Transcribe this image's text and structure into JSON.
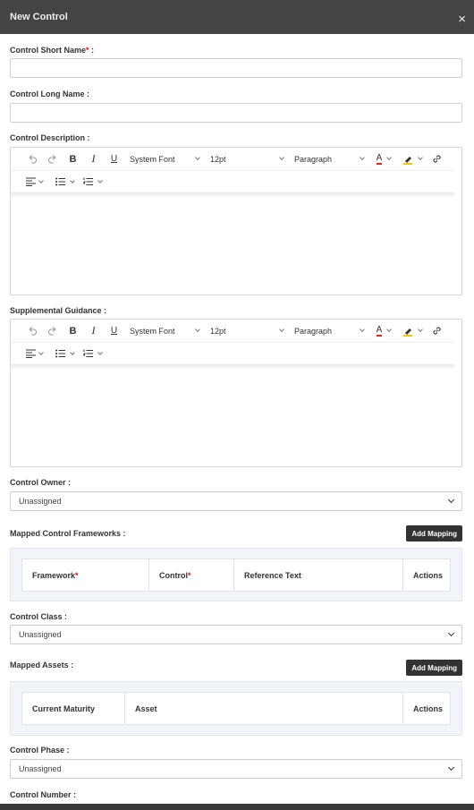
{
  "modal": {
    "title": "New Control",
    "close_glyph": "×"
  },
  "fields": {
    "short_name_label": "Control Short Name",
    "short_name_req": "*",
    "short_name_suffix": " :",
    "long_name_label": "Control Long Name :",
    "description_label": "Control Description :",
    "supplemental_label": "Supplemental Guidance :",
    "owner_label": "Control Owner :",
    "owner_value": "Unassigned",
    "frameworks_label": "Mapped Control Frameworks :",
    "class_label": "Control Class :",
    "class_value": "Unassigned",
    "assets_label": "Mapped Assets :",
    "phase_label": "Control Phase :",
    "phase_value": "Unassigned",
    "number_label": "Control Number :"
  },
  "editor_toolbar": {
    "undo_icon": "undo-icon",
    "redo_icon": "redo-icon",
    "bold": "B",
    "italic": "I",
    "underline": "U",
    "font_family": "System Font",
    "font_size": "12pt",
    "block_format": "Paragraph",
    "text_color_glyph": "A",
    "text_color": "#e02020",
    "highlight_color": "#f5c400"
  },
  "frameworks_table": {
    "add_button": "Add Mapping",
    "col_framework": "Framework",
    "col_control": "Control",
    "req": "*",
    "col_reference": "Reference Text",
    "col_actions": "Actions"
  },
  "assets_table": {
    "add_button": "Add Mapping",
    "col_maturity": "Current Maturity",
    "col_asset": "Asset",
    "col_actions": "Actions"
  }
}
